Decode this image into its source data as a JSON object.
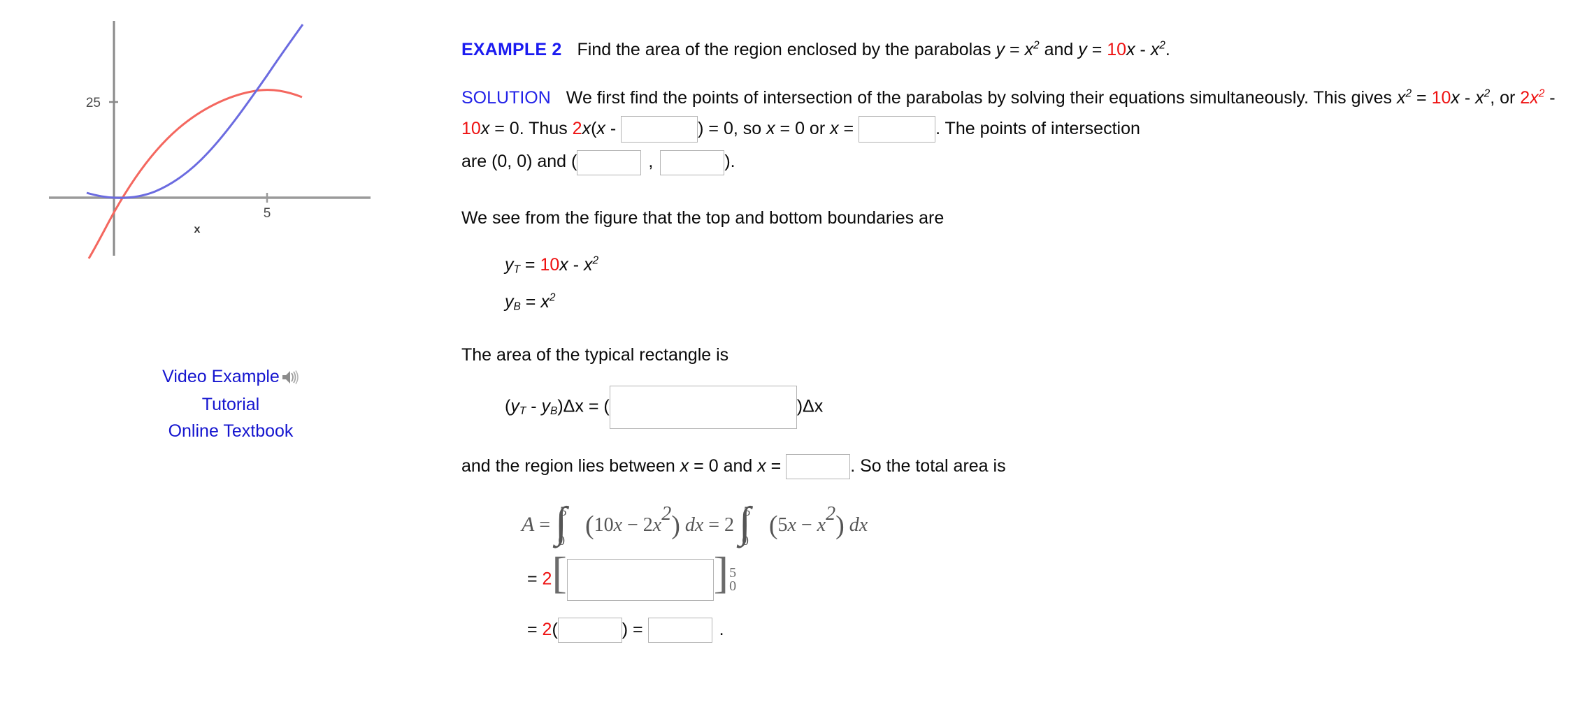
{
  "figure": {
    "y_tick_label": "25",
    "x_tick_label": "5",
    "x_axis_name": "x",
    "curve_red_name": "parabola-10x-minus-x-squared",
    "curve_blue_name": "parabola-x-squared",
    "colors": {
      "red_curve": "#f4675f",
      "blue_curve": "#6b6be0",
      "axis": "#8c8c8c"
    },
    "chart_data": {
      "type": "line",
      "title": "",
      "xlabel": "x",
      "ylabel": "",
      "xlim": [
        -1.2,
        7.6
      ],
      "ylim": [
        -9,
        46
      ],
      "grid": false,
      "legend": "none",
      "annotations": [
        "25",
        "5",
        "x"
      ],
      "series": [
        {
          "name": "y = 10x - x^2",
          "color": "#f4675f",
          "expression": "10*x - x*x",
          "x": [
            -0.9,
            -0.5,
            0,
            0.5,
            1,
            1.5,
            2,
            2.5,
            3,
            3.5,
            4,
            4.5,
            5,
            5.5,
            6,
            6.5,
            7,
            7.5
          ],
          "y": [
            -9.81,
            -5.25,
            0,
            4.75,
            9,
            12.75,
            16,
            18.75,
            21,
            22.75,
            24,
            24.75,
            25,
            24.75,
            24,
            22.75,
            21,
            18.75
          ]
        },
        {
          "name": "y = x^2",
          "color": "#6b6be0",
          "expression": "x*x",
          "x": [
            -1.2,
            -0.9,
            -0.5,
            0,
            0.5,
            1,
            1.5,
            2,
            2.5,
            3,
            3.5,
            4,
            4.5,
            5,
            5.5,
            6,
            6.3
          ],
          "y": [
            1.44,
            0.81,
            0.25,
            0,
            0.25,
            1,
            2.25,
            4,
            6.25,
            9,
            12.25,
            16,
            20.25,
            25,
            30.25,
            36,
            39.69
          ]
        }
      ],
      "intersections": [
        [
          0,
          0
        ],
        [
          5,
          25
        ]
      ]
    }
  },
  "links": [
    {
      "label": "Video Example",
      "icon": "speaker-icon"
    },
    {
      "label": "Tutorial",
      "icon": ""
    },
    {
      "label": "Online Textbook",
      "icon": ""
    }
  ],
  "problem": {
    "example_label": "EXAMPLE 2",
    "statement_a": "Find the area of the region enclosed by the parabolas ",
    "statement_y1": "y",
    "statement_eq1": " = ",
    "statement_x1": "x",
    "statement_pow1": "2",
    "statement_and": " and ",
    "statement_y2": "y",
    "statement_eq2": " = ",
    "statement_ten": "10",
    "statement_x2": "x",
    "statement_minus": " - ",
    "statement_x3": "x",
    "statement_pow2": "2",
    "statement_end": ".",
    "solution_label": "SOLUTION",
    "solution_p1": "We first find the points of intersection of the parabolas by solving their equations simultaneously. This gives ",
    "gives_x": "x",
    "gives_pow": "2",
    "gives_eq": " = ",
    "gives_ten": "10",
    "gives_x2": "x",
    "gives_minus": " - ",
    "gives_x3": "x",
    "gives_pow2": "2",
    "gives_comma_or": ", or ",
    "two_a": "2",
    "x_a": "x",
    "pow_a": "2",
    "minus_b": " - ",
    "ten_b": "10",
    "x_b": "x",
    "eq_zero": " = 0. Thus ",
    "two_b": "2",
    "x_c": "x",
    "paren_open": "(",
    "x_d": "x",
    "dash_sp": " - ",
    "after_box1": ") = 0, so ",
    "x_e": "x",
    "eq_0_or": " = 0 or ",
    "x_f": "x",
    "eq_sp": " = ",
    "after_box2": ". The points of intersection",
    "are_text": "are (0, 0) and (",
    "comma": ",",
    "close_paren": ").",
    "figure_sentence": "We see from the figure that the top and bottom boundaries are",
    "yT_y": "y",
    "yT_sub": "T",
    "yT_eq": " = ",
    "yT_ten": "10",
    "yT_x": "x",
    "yT_minus": " - ",
    "yT_x2": "x",
    "yT_pow": "2",
    "yB_y": "y",
    "yB_sub": "B",
    "yB_eq": " = ",
    "yB_x": "x",
    "yB_pow": "2",
    "rect_sentence": "The area of the typical rectangle is",
    "rect_open": "(",
    "rect_yT_y": "y",
    "rect_yT_sub": "T",
    "rect_minus": " - ",
    "rect_yB_y": "y",
    "rect_yB_sub": "B",
    "rect_close_dx": ")Δx = (",
    "rect_tail": ")Δx",
    "between_a": "and the region lies between ",
    "between_x1": "x",
    "between_eq0": " = 0 and ",
    "between_x2": "x",
    "between_eq": " = ",
    "between_tail": ". So the total area is",
    "integral": {
      "A": "A",
      "eq1": "=",
      "upper1": "5",
      "lower1": "0",
      "body1_open": "(",
      "body1_ten": "10",
      "body1_x": "x",
      "body1_minus": "−",
      "body1_two": "2",
      "body1_x2": "x",
      "body1_pow": "2",
      "body1_close": ")",
      "dx1": "dx",
      "eq2": "=",
      "coef2": "2",
      "upper2": "5",
      "lower2": "0",
      "body2_open": "(",
      "body2_five": "5",
      "body2_x": "x",
      "body2_minus": "−",
      "body2_x2": "x",
      "body2_pow": "2",
      "body2_close": ")",
      "dx2": "dx"
    },
    "line_eq_bracket": "= ",
    "line_two_red": "2",
    "bracket_open": "[",
    "bracket_close": "]",
    "bracket_upper": "5",
    "bracket_lower": "0",
    "final_eq": "= ",
    "final_two_red": "2",
    "final_open": "(",
    "final_close": ") = ",
    "final_period": "."
  },
  "inputs": {
    "box_factor": "",
    "box_x_value": "",
    "box_point_x": "",
    "box_point_y": "",
    "box_rect_expr": "",
    "box_upper_limit": "",
    "box_antideriv": "",
    "box_eval": "",
    "box_area": "",
    "placeholder": ""
  },
  "colors": {
    "example_blue": "#1b1bf0",
    "solution_blue": "#2222e8",
    "accent_red": "#ee1111",
    "link_blue": "#1515cf",
    "box_border": "#b3b3b3",
    "tex_gray": "#555555"
  }
}
